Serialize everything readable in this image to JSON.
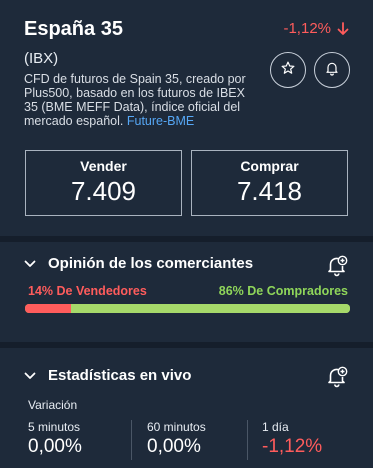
{
  "instrument": {
    "name": "España 35",
    "symbol": "(IBX)",
    "change": "-1,12%",
    "description": "CFD de futuros de Spain 35, creado por Plus500, basado en los futuros de IBEX 35 (BME MEFF Data), índice oficial del mercado español.",
    "description_link": "Future-BME"
  },
  "quote": {
    "sell_label": "Vender",
    "sell_value": "7.409",
    "buy_label": "Comprar",
    "buy_value": "7.418"
  },
  "sentiment": {
    "title": "Opinión de los comerciantes",
    "sellers_label": "14% De Vendedores",
    "buyers_label": "86% De Compradores",
    "sellers_pct": 14,
    "buyers_pct": 86
  },
  "stats": {
    "title": "Estadísticas en vivo",
    "variation_label": "Variación",
    "items": [
      {
        "label": "5 minutos",
        "value": "0,00%"
      },
      {
        "label": "60 minutos",
        "value": "0,00%"
      },
      {
        "label": "1 día",
        "value": "-1,12%"
      }
    ]
  },
  "icons": {
    "change_arrow": "arrow-down-icon",
    "favorite": "star-icon",
    "alert": "bell-icon",
    "section_toggle": "chevron-down-icon",
    "add_alert": "bell-plus-icon"
  },
  "colors": {
    "background": "#1e2a3a",
    "negative": "#ff5c5c",
    "positive": "#a6d96a",
    "link": "#56a7f5"
  }
}
